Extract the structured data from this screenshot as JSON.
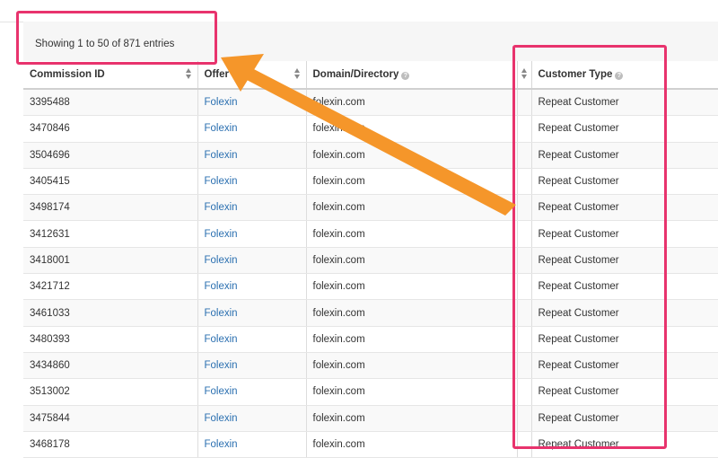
{
  "info": {
    "showing": "Showing 1 to 50 of 871 entries"
  },
  "columns": {
    "commission_id": "Commission ID",
    "offer": "Offer",
    "domain": "Domain/Directory",
    "customer_type": "Customer Type"
  },
  "rows": [
    {
      "id": "3395488",
      "offer": "Folexin",
      "domain": "folexin.com",
      "type": "Repeat Customer"
    },
    {
      "id": "3470846",
      "offer": "Folexin",
      "domain": "folexin.com",
      "type": "Repeat Customer"
    },
    {
      "id": "3504696",
      "offer": "Folexin",
      "domain": "folexin.com",
      "type": "Repeat Customer"
    },
    {
      "id": "3405415",
      "offer": "Folexin",
      "domain": "folexin.com",
      "type": "Repeat Customer"
    },
    {
      "id": "3498174",
      "offer": "Folexin",
      "domain": "folexin.com",
      "type": "Repeat Customer"
    },
    {
      "id": "3412631",
      "offer": "Folexin",
      "domain": "folexin.com",
      "type": "Repeat Customer"
    },
    {
      "id": "3418001",
      "offer": "Folexin",
      "domain": "folexin.com",
      "type": "Repeat Customer"
    },
    {
      "id": "3421712",
      "offer": "Folexin",
      "domain": "folexin.com",
      "type": "Repeat Customer"
    },
    {
      "id": "3461033",
      "offer": "Folexin",
      "domain": "folexin.com",
      "type": "Repeat Customer"
    },
    {
      "id": "3480393",
      "offer": "Folexin",
      "domain": "folexin.com",
      "type": "Repeat Customer"
    },
    {
      "id": "3434860",
      "offer": "Folexin",
      "domain": "folexin.com",
      "type": "Repeat Customer"
    },
    {
      "id": "3513002",
      "offer": "Folexin",
      "domain": "folexin.com",
      "type": "Repeat Customer"
    },
    {
      "id": "3475844",
      "offer": "Folexin",
      "domain": "folexin.com",
      "type": "Repeat Customer"
    },
    {
      "id": "3468178",
      "offer": "Folexin",
      "domain": "folexin.com",
      "type": "Repeat Customer"
    }
  ],
  "colors": {
    "highlight": "#e8336d",
    "arrow": "#f5962a",
    "link": "#2a6fb0"
  },
  "icons": {
    "sort": "sort-arrows-icon",
    "help": "question-circle-icon"
  }
}
